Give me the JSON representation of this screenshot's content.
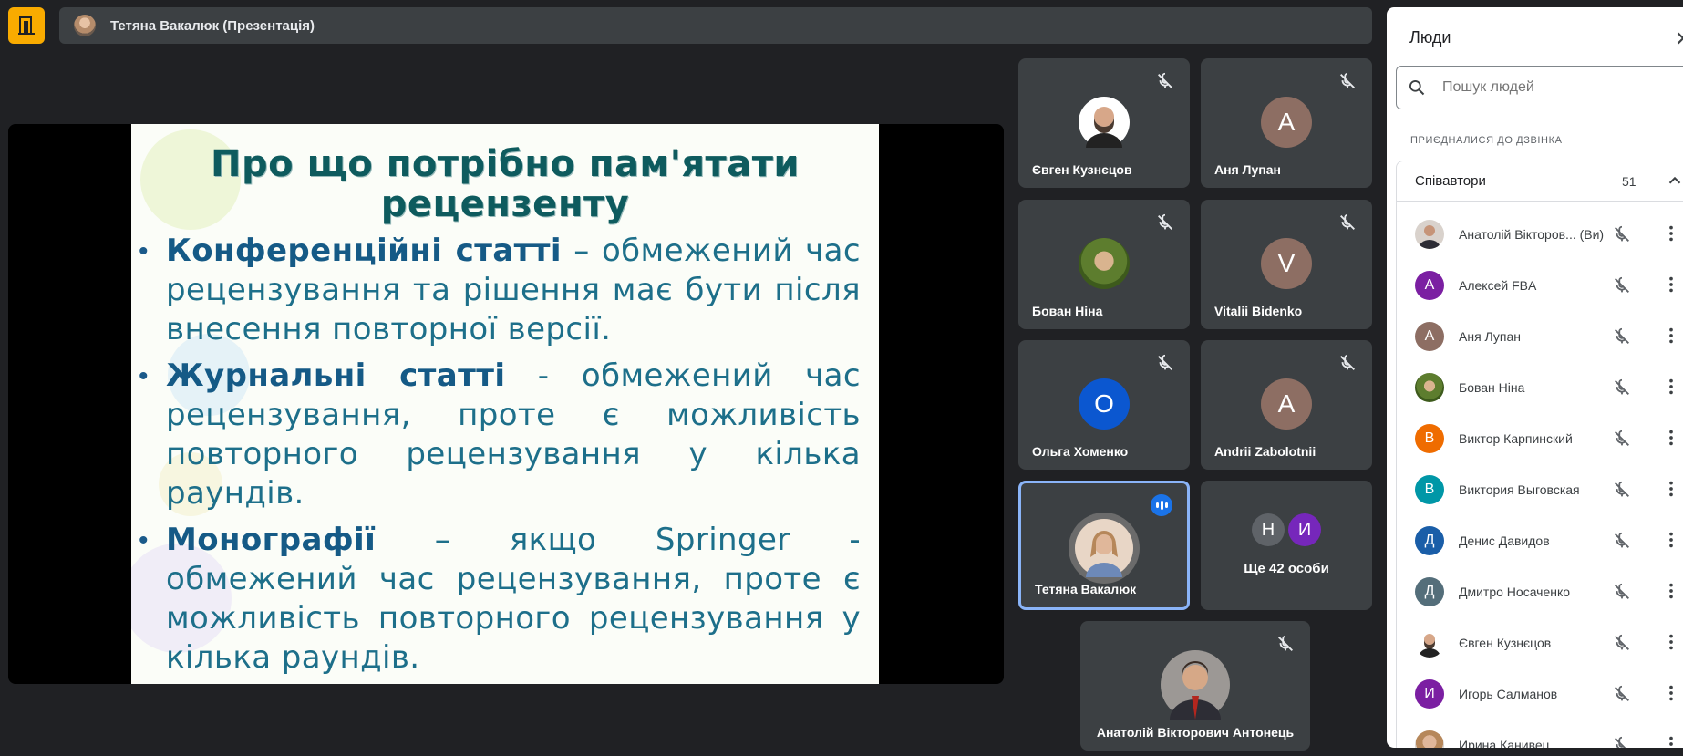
{
  "header": {
    "meeting_title": "Тетяна Вакалюк (Презентація)"
  },
  "slide": {
    "title": "Про що потрібно пам'ятати рецензенту",
    "bullets": [
      {
        "term": "Конференційні статті",
        "text": " – обмежений час рецензування та рішення має бути після внесення повторної версії."
      },
      {
        "term": "Журнальні статті",
        "text": " - обмежений час рецензування, проте є можливість повторного рецензування у кілька раундів."
      },
      {
        "term": "Монографії",
        "text": " – якщо Springer - обмежений час рецензування, проте є можливість повторного рецензування у кілька раундів."
      }
    ]
  },
  "tiles": [
    {
      "name": "Євген Кузнєцов",
      "avatar": "photo",
      "color": "#ffffff"
    },
    {
      "name": "Аня Лупан",
      "initial": "А",
      "color": "#8d6e63"
    },
    {
      "name": "Бован Ніна",
      "avatar": "photo",
      "color": "#4e7a3a"
    },
    {
      "name": "Vitalii Bidenko",
      "initial": "V",
      "color": "#8d6e63"
    },
    {
      "name": "Ольга Хоменко",
      "initial": "О",
      "color": "#0b57d0"
    },
    {
      "name": "Andrii Zabolotnii",
      "initial": "А",
      "color": "#8d6e63"
    },
    {
      "name": "Тетяна Вакалюк",
      "avatar": "photo",
      "color": "#c9a27e"
    },
    {
      "name": "Ще 42 особи",
      "extra_initials": [
        "Н",
        "И"
      ],
      "extra_colors": [
        "#5f6368",
        "#7627bb"
      ]
    },
    {
      "name": "Анатолій Вікторович Антонець",
      "avatar": "photo",
      "color": "#a1887f"
    }
  ],
  "people_panel": {
    "title": "Люди",
    "search_placeholder": "Пошук людей",
    "section_label": "ПРИЄДНАЛИСЯ ДО ДЗВІНКА",
    "group_name": "Співавтори",
    "group_count": "51",
    "people": [
      {
        "name": "Анатолій Вікторов... (Ви)",
        "initial": "",
        "color": "#8d8d8d"
      },
      {
        "name": "Алексей FBA",
        "initial": "А",
        "color": "#7b1fa2"
      },
      {
        "name": "Аня Лупан",
        "initial": "А",
        "color": "#8d6e63"
      },
      {
        "name": "Бован Ніна",
        "initial": "",
        "color": "#4e7a3a"
      },
      {
        "name": "Виктор Карпинский",
        "initial": "В",
        "color": "#ef6c00"
      },
      {
        "name": "Виктория Выговская",
        "initial": "В",
        "color": "#0097a7"
      },
      {
        "name": "Денис Давидов",
        "initial": "Д",
        "color": "#1a5ea8"
      },
      {
        "name": "Дмитро Носаченко",
        "initial": "Д",
        "color": "#546e7a"
      },
      {
        "name": "Євген Кузнєцов",
        "initial": "",
        "color": "#ffffff"
      },
      {
        "name": "Игорь Салманов",
        "initial": "И",
        "color": "#7b1fa2"
      },
      {
        "name": "Ирина Канивец",
        "initial": "",
        "color": "#c9a27e"
      }
    ]
  }
}
